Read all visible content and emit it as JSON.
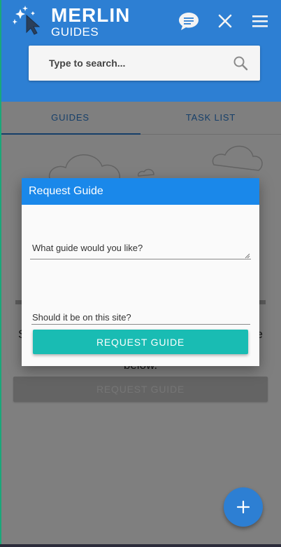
{
  "logo": {
    "line1": "MERLIN",
    "line2": "GUIDES"
  },
  "header": {
    "icons": [
      "chat-icon",
      "close-icon",
      "menu-icon"
    ],
    "color": "#2d7fd3"
  },
  "search": {
    "placeholder": "Type to search..."
  },
  "tabs": [
    {
      "label": "GUIDES",
      "active": true
    },
    {
      "label": "TASK LIST",
      "active": false
    }
  ],
  "background": {
    "intro_text_left": "S",
    "intro_text_right": "e",
    "intro_text_bottom": "below.",
    "request_button_label": "REQUEST GUIDE"
  },
  "dialog": {
    "title": "Request Guide",
    "guide_placeholder": "What guide would you like?",
    "site_placeholder": "Should it be on this site?",
    "submit_label": "REQUEST GUIDE",
    "header_color": "#1a88ea",
    "button_color": "#19bcb3"
  },
  "fab": {
    "icon": "plus-icon"
  }
}
